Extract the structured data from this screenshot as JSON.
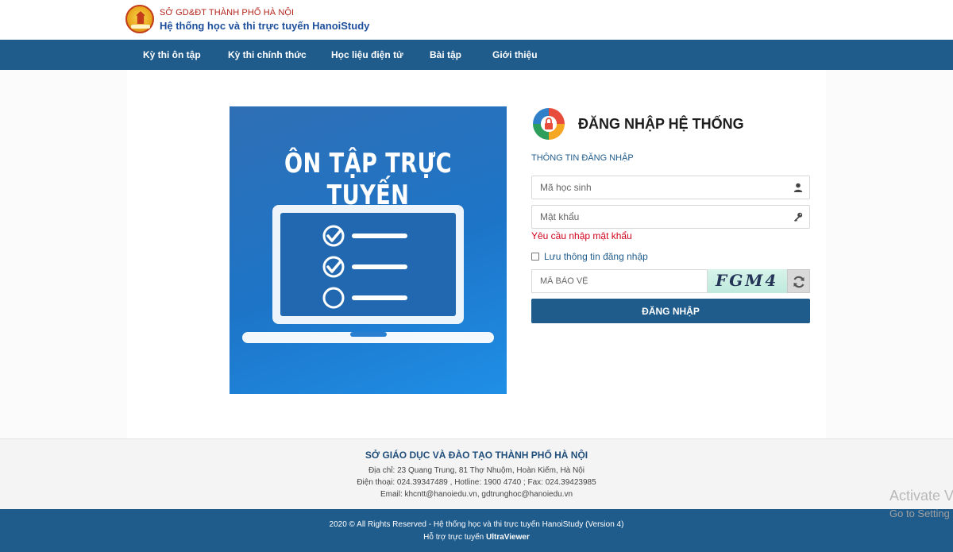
{
  "header": {
    "org_small": "SỞ GD&ĐT THÀNH PHỐ HÀ NỘI",
    "system_name": "Hệ thống học và thi trực tuyến HanoiStudy"
  },
  "nav": {
    "items": [
      {
        "label": "Kỳ thi ôn tập"
      },
      {
        "label": "Kỳ thi chính thức"
      },
      {
        "label": "Học liệu điện tử"
      },
      {
        "label": "Bài tập"
      },
      {
        "label": "Giới thiệu"
      }
    ]
  },
  "hero": {
    "title": "ÔN TẬP TRỰC TUYẾN"
  },
  "login": {
    "title": "ĐĂNG NHẬP HỆ THỐNG",
    "section_label": "THÔNG TIN ĐĂNG NHẬP",
    "username_placeholder": "Mã học sinh",
    "username_value": "",
    "password_placeholder": "Mật khẩu",
    "password_value": "",
    "password_error": "Yêu cầu nhập mật khẩu",
    "remember_label": "Lưu thông tin đăng nhập",
    "remember_checked": false,
    "captcha_placeholder": "MÃ BẢO VỆ",
    "captcha_value": "",
    "captcha_text": "FGM4",
    "submit_label": "ĐĂNG NHẬP"
  },
  "footer": {
    "org": "SỞ GIÁO DỤC VÀ ĐÀO TẠO THÀNH PHỐ HÀ NỘI",
    "address": "Địa chỉ: 23 Quang Trung, 81 Thợ Nhuộm, Hoàn Kiếm, Hà Nội",
    "phone": "Điện thoại: 024.39347489 , Hotline: 1900 4740 ; Fax: 024.39423985",
    "email": "Email: khcntt@hanoiedu.vn, gdtrunghoc@hanoiedu.vn",
    "copyright": "2020 © All Rights Reserved - Hệ thống học và thi trực tuyến HanoiStudy (Version 4)",
    "support_prefix": "Hỗ trợ trực tuyến",
    "support_tool": "UltraViewer"
  },
  "os_watermark": {
    "line1": "Activate V",
    "line2": "Go to Setting"
  },
  "colors": {
    "primary": "#1f5b8b",
    "error": "#d0021b",
    "brand_red": "#b3261e"
  }
}
